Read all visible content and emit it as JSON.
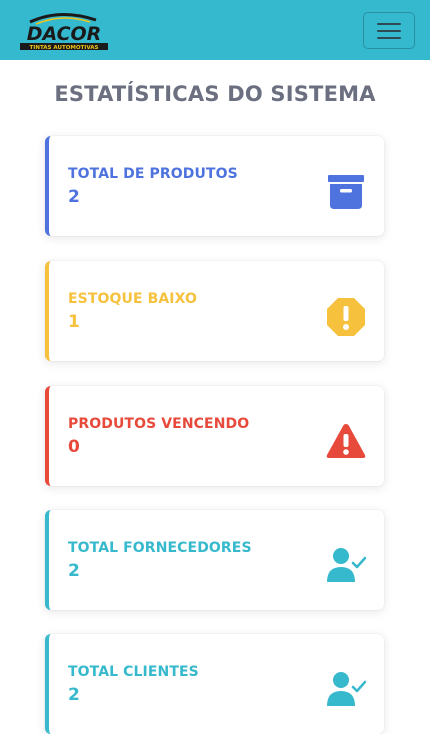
{
  "navbar": {
    "logo_text": "DACOR",
    "logo_subtext": "TINTAS AUTOMOTIVAS",
    "menu_toggle_icon": "hamburger-icon",
    "bg_color": "#35b9cf"
  },
  "page": {
    "title": "ESTATÍSTICAS DO SISTEMA"
  },
  "cards": [
    {
      "label": "TOTAL DE PRODUTOS",
      "value": "2",
      "color": "#4e73df",
      "icon": "archive-box-icon"
    },
    {
      "label": "ESTOQUE BAIXO",
      "value": "1",
      "color": "#f6c23e",
      "icon": "warning-octagon-icon"
    },
    {
      "label": "PRODUTOS VENCENDO",
      "value": "0",
      "color": "#e74a3b",
      "icon": "warning-triangle-icon"
    },
    {
      "label": "TOTAL FORNECEDORES",
      "value": "2",
      "color": "#36b9cc",
      "icon": "user-check-icon"
    },
    {
      "label": "TOTAL CLIENTES",
      "value": "2",
      "color": "#36b9cc",
      "icon": "user-check-icon"
    }
  ]
}
